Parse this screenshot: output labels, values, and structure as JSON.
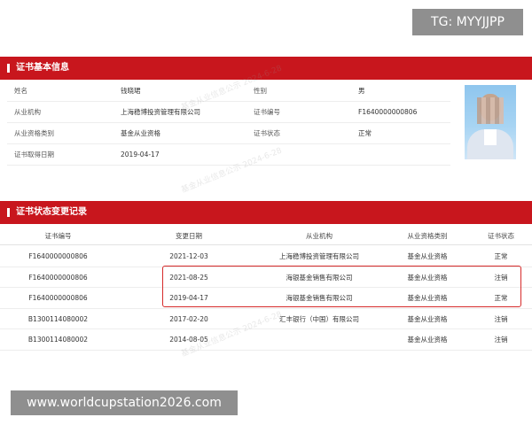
{
  "overlay": {
    "tg_handle": "TG: MYYJJPP",
    "website": "www.worldcupstation2026.com"
  },
  "cert_info": {
    "section_title": "证书基本信息",
    "rows": [
      {
        "label1": "姓名",
        "value1": "钱晓珺",
        "label2": "性别",
        "value2": "男"
      },
      {
        "label1": "从业机构",
        "value1": "上海稳博投资管理有限公司",
        "label2": "证书编号",
        "value2": "F1640000000806"
      },
      {
        "label1": "从业资格类别",
        "value1": "基金从业资格",
        "label2": "证书状态",
        "value2": "正常"
      },
      {
        "label1": "证书取得日期",
        "value1": "2019-04-17",
        "label2": "",
        "value2": ""
      }
    ]
  },
  "status_history": {
    "section_title": "证书状态变更记录",
    "headers": [
      "证书编号",
      "变更日期",
      "从业机构",
      "从业资格类别",
      "证书状态"
    ],
    "rows": [
      [
        "F1640000000806",
        "2021-12-03",
        "上海稳博投资管理有限公司",
        "基金从业资格",
        "正常"
      ],
      [
        "F1640000000806",
        "2021-08-25",
        "海银基金销售有限公司",
        "基金从业资格",
        "注销"
      ],
      [
        "F1640000000806",
        "2019-04-17",
        "海银基金销售有限公司",
        "基金从业资格",
        "正常"
      ],
      [
        "B1300114080002",
        "2017-02-20",
        "汇丰银行（中国）有限公司",
        "基金从业资格",
        "注销"
      ],
      [
        "B1300114080002",
        "2014-08-05",
        "",
        "基金从业资格",
        "注销"
      ]
    ]
  },
  "watermark": {
    "text1": "基金从业信息公示 2024-6-28",
    "text2": "基金从业信息公示 2024-6-28",
    "text3": "基金从业信息公示 2024-6-28"
  },
  "colors": {
    "header_red": "#c8161d",
    "highlight_red": "#d62a2a"
  }
}
